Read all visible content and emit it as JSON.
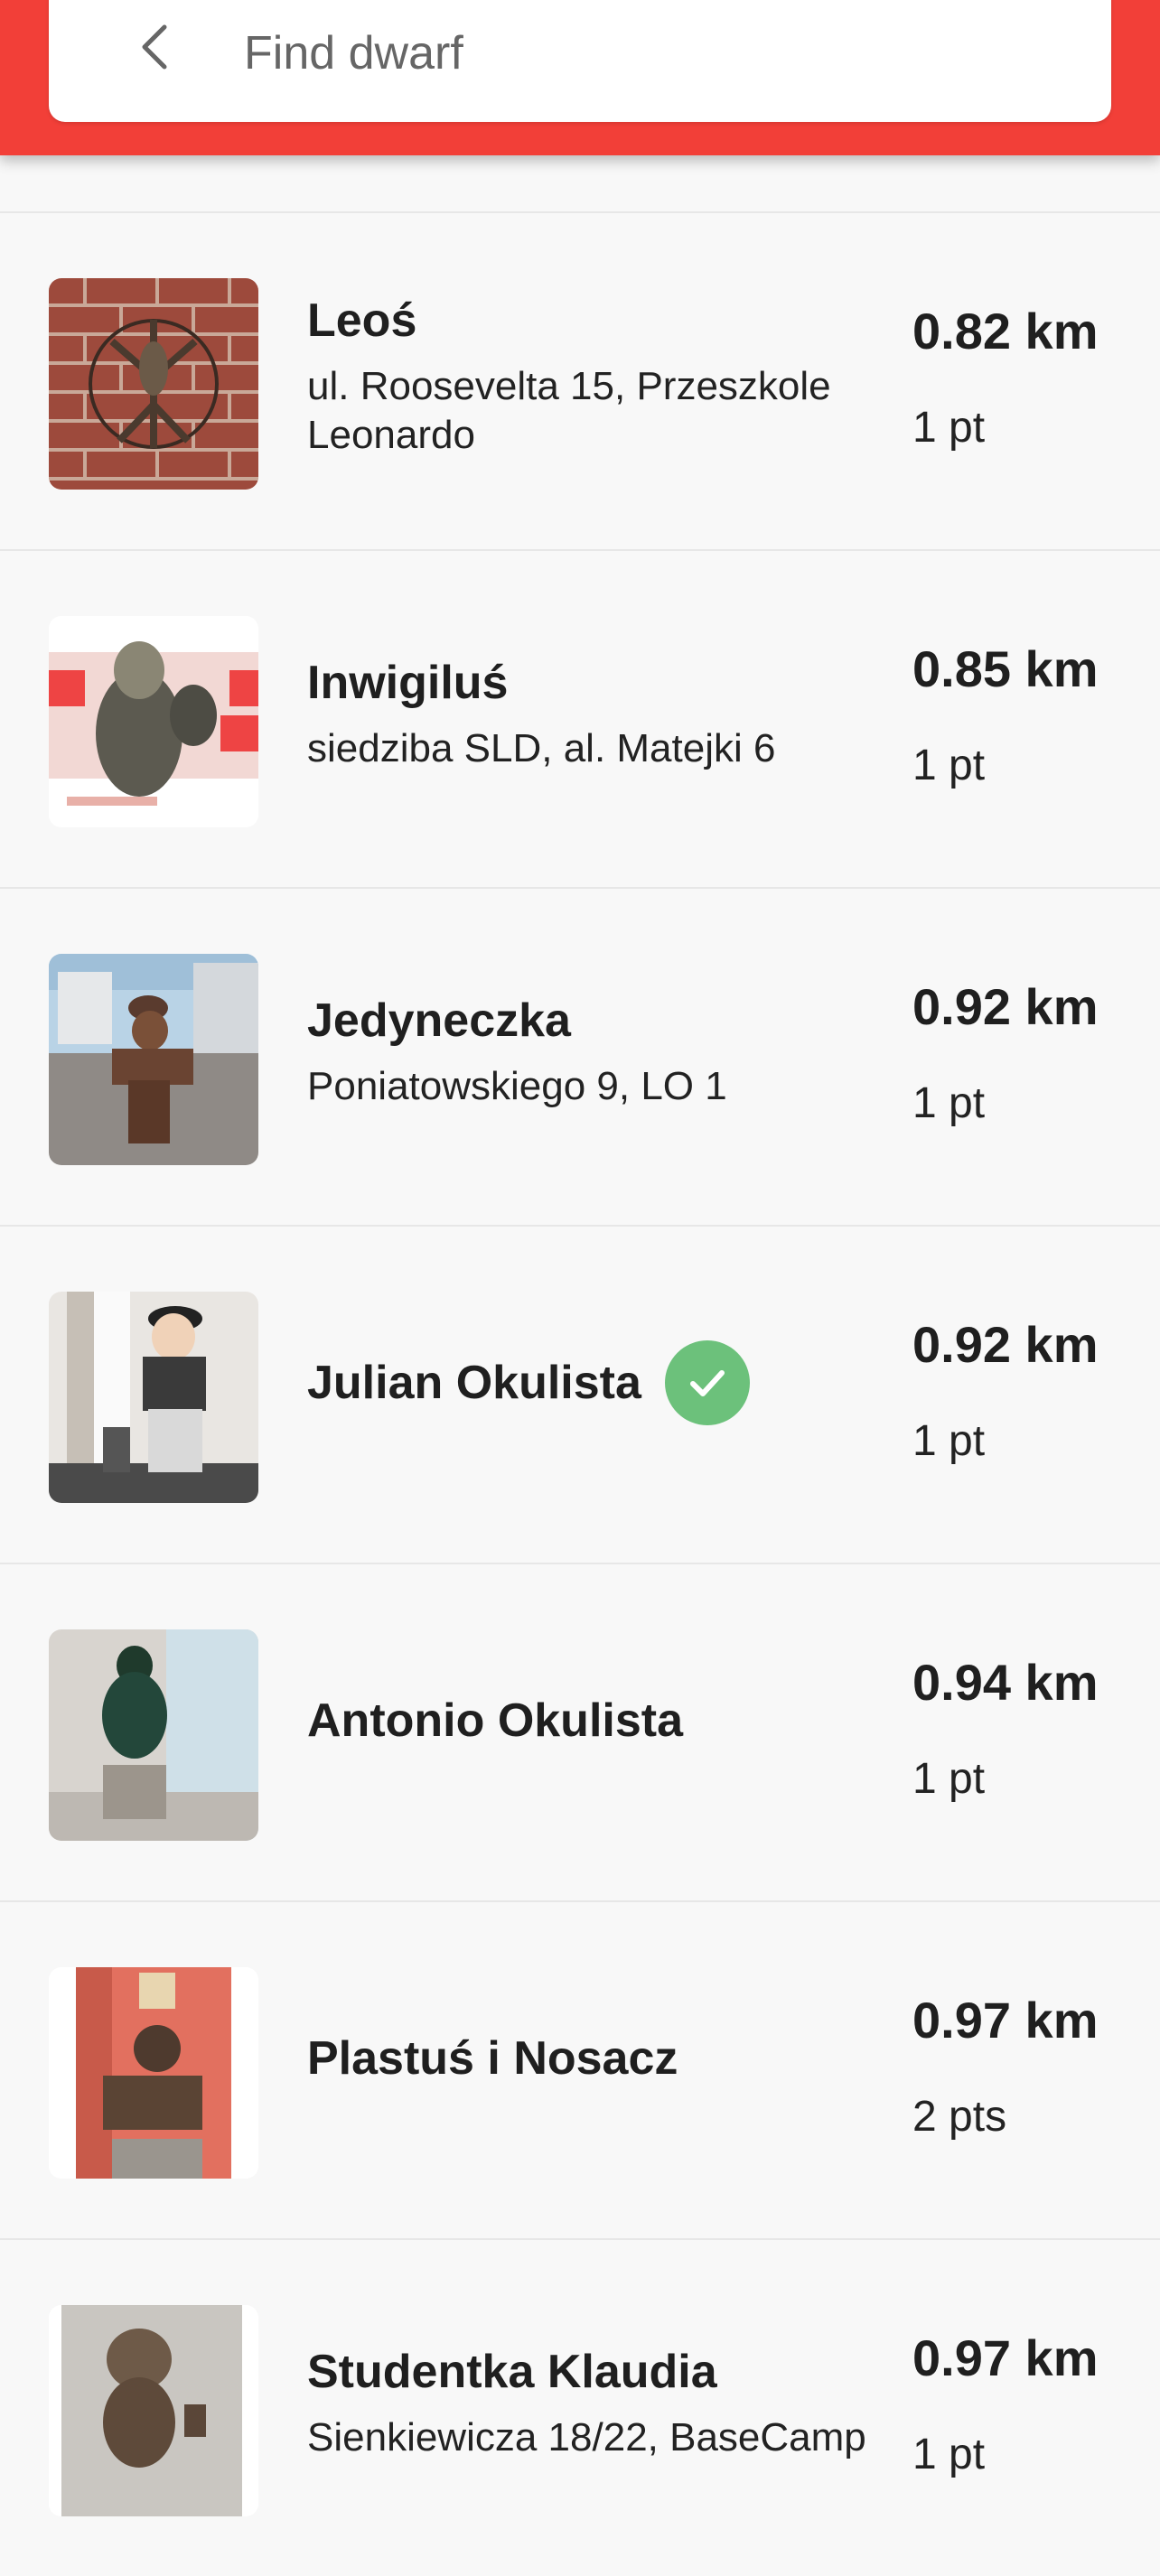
{
  "search": {
    "placeholder": "Find dwarf",
    "value": ""
  },
  "dwarfs": [
    {
      "name": "Leoś",
      "address": "ul. Roosevelta 15, Przeszkole Leonardo",
      "distance": "0.82 km",
      "points": "1 pt",
      "visited": false
    },
    {
      "name": "Inwigiluś",
      "address": "siedziba SLD, al. Matejki 6",
      "distance": "0.85 km",
      "points": "1 pt",
      "visited": false
    },
    {
      "name": "Jedyneczka",
      "address": "Poniatowskiego 9, LO 1",
      "distance": "0.92 km",
      "points": "1 pt",
      "visited": false
    },
    {
      "name": "Julian Okulista",
      "address": "",
      "distance": "0.92 km",
      "points": "1 pt",
      "visited": true
    },
    {
      "name": "Antonio Okulista",
      "address": "",
      "distance": "0.94 km",
      "points": "1 pt",
      "visited": false
    },
    {
      "name": "Plastuś i Nosacz",
      "address": "",
      "distance": "0.97 km",
      "points": "2 pts",
      "visited": false
    },
    {
      "name": "Studentka Klaudia",
      "address": "Sienkiewicza 18/22, BaseCamp",
      "distance": "0.97 km",
      "points": "1 pt",
      "visited": false
    }
  ],
  "icons": {
    "back": "chevron-left-icon",
    "visited": "check-circle-icon"
  },
  "colors": {
    "accent": "#f23f38",
    "visited": "#6cc17b"
  }
}
